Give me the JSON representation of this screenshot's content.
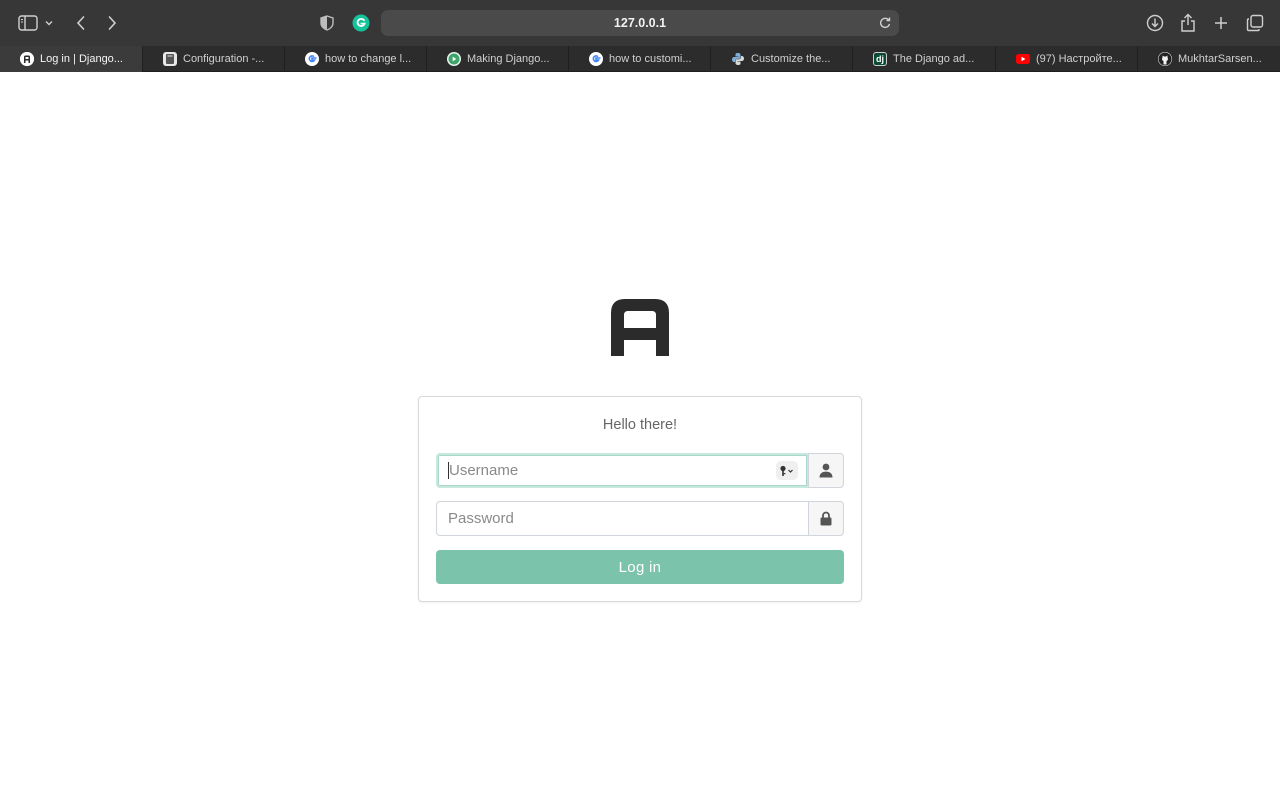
{
  "browser": {
    "url": "127.0.0.1",
    "tabs": [
      {
        "title": "Log in | Django...",
        "favicon": "django-admin-logo-icon",
        "active": true
      },
      {
        "title": "Configuration -...",
        "favicon": "docs-book-icon"
      },
      {
        "title": "how to change l...",
        "favicon": "google-icon"
      },
      {
        "title": "Making Django...",
        "favicon": "green-play-icon"
      },
      {
        "title": "how to customi...",
        "favicon": "google-icon"
      },
      {
        "title": "Customize the...",
        "favicon": "python-icon"
      },
      {
        "title": "The Django ad...",
        "favicon": "django-icon",
        "favicon_text": "dj"
      },
      {
        "title": "(97) Настройте...",
        "favicon": "youtube-icon"
      },
      {
        "title": "MukhtarSarsen...",
        "favicon": "github-icon"
      }
    ]
  },
  "login": {
    "greeting": "Hello there!",
    "username_placeholder": "Username",
    "password_placeholder": "Password",
    "submit_label": "Log in"
  },
  "colors": {
    "toolbar": "#373737",
    "tabbar": "#2c2c2c",
    "accent": "#7bc4ab",
    "grammarly": "#15c39a"
  }
}
